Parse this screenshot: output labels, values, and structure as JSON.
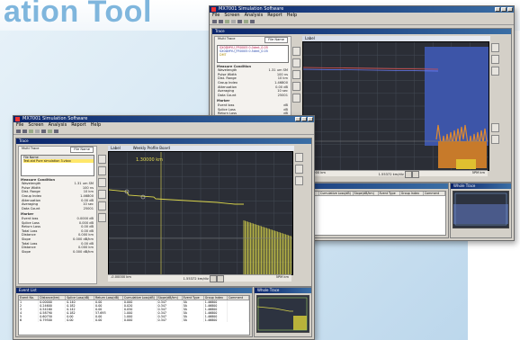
{
  "banner": {
    "title": "ation Tool"
  },
  "colors": {
    "plot_bg": "#2b2e36",
    "trace": "#d8d34a",
    "title_bar": "#0a246a"
  },
  "back_window": {
    "title": "MX7001 Simulation Software",
    "menu": [
      "File",
      "Screen",
      "Analysis",
      "Report",
      "Help"
    ],
    "frame_title": "Trace",
    "panel": {
      "select_label": "Multi Trace",
      "select_value": "File Name",
      "files": [
        "SX0DMYU_FR0005 0.0dmt_0.05",
        "SX0DMYU_FR0005 0.5dmt_0.05",
        "DMT"
      ],
      "sect_measure": "Measure Condition",
      "measure": [
        [
          "Wavelength",
          "1.31 um SM"
        ],
        [
          "Pulse Width",
          "100 ns"
        ],
        [
          "Dist. Range",
          "10 km"
        ],
        [
          "Group Index",
          "1.46800"
        ],
        [
          "Attenuation",
          "0.00 dB"
        ],
        [
          "Averaging",
          "10 sec"
        ],
        [
          "Data Count",
          "25001"
        ]
      ],
      "sect_marker": "Marker",
      "marker": [
        [
          "Event loss",
          "dB"
        ],
        [
          "Splice Loss",
          "dB"
        ],
        [
          "Return Loss",
          "dB"
        ],
        [
          "Distance",
          "dB"
        ],
        [
          "Slope",
          "dB/km"
        ],
        [
          "Total Loss",
          "dB"
        ],
        [
          "Distance",
          "km"
        ],
        [
          "Slope",
          "dB/km"
        ]
      ]
    },
    "plot_tab": "Label",
    "status": {
      "left": "-0.00000 km",
      "mid": "1.55372 km/div",
      "right": "5PM   km"
    },
    "event_title": "Event List",
    "event_cols": [
      "Event No.",
      "Distance(km)",
      "Splice Loss(dB)",
      "Return Loss(dB)",
      "Cumulative Loss(dB)",
      "Slope(dB/km)",
      "Event Type",
      "Group Index",
      "Comment"
    ],
    "mini_title": "Whole Trace"
  },
  "front_window": {
    "title": "MX7001 Simulation Software",
    "menu": [
      "File",
      "Screen",
      "Analysis",
      "Report",
      "Help"
    ],
    "frame_title": "Trace",
    "panel": {
      "select_label": "Multi Trace",
      "select_value": "File Name",
      "files": [
        "File Name",
        "Test.std Pure simulation 3.vbxx"
      ],
      "sect_measure": "Measure Condition",
      "measure": [
        [
          "Wavelength",
          "1.31 um SM"
        ],
        [
          "Pulse Width",
          "100 ns"
        ],
        [
          "Dist. Range",
          "10 km"
        ],
        [
          "Group Index",
          "1.46800"
        ],
        [
          "Attenuation",
          "0.00 dB"
        ],
        [
          "Averaging",
          "10 sec"
        ],
        [
          "Data Count",
          "25001"
        ]
      ],
      "sect_marker": "Marker",
      "marker": [
        [
          "Event loss",
          "0.0000 dB"
        ],
        [
          "Splice Loss",
          "0.000 dB"
        ],
        [
          "Return Loss",
          "0.00 dB"
        ],
        [
          "Total Loss",
          "0.00 dB"
        ],
        [
          "Distance",
          "0.000 km"
        ],
        [
          "Slope",
          "0.000 dB/km"
        ],
        [
          "Total Loss",
          "0.00 dB"
        ],
        [
          "Distance",
          "0.000 km"
        ],
        [
          "Slope",
          "0.000 dB/km"
        ]
      ]
    },
    "plot_tabs": [
      "Label",
      "Weekly Profile Board"
    ],
    "plot_readout": "1.30000 km",
    "status": {
      "left": "-0.00000 km",
      "mid": "1.55372 km/div",
      "right": "5PM   km"
    },
    "event_title": "Event List",
    "event_cols": [
      "Event No.",
      "Distance(km)",
      "Splice Loss(dB)",
      "Return Loss(dB)",
      "Cumulative Loss(dB)",
      "Slope(dB/km)",
      "Event Type",
      "Group Index",
      "Comment"
    ],
    "event_rows": [
      [
        "1",
        "0.00000",
        "0.140",
        "0.00",
        "0.000",
        "0.347",
        "5A",
        "1.46800",
        ""
      ],
      [
        "2",
        "0.24600",
        "0.182",
        "0.00",
        "0.020",
        "0.347",
        "5A",
        "1.46800",
        ""
      ],
      [
        "3",
        "0.54160",
        "0.142",
        "0.00",
        "0.050",
        "0.347",
        "5A",
        "1.46800",
        ""
      ],
      [
        "4",
        "0.58790",
        "0.182",
        "57.693",
        "1.000",
        "0.347",
        "5A",
        "1.46800",
        ""
      ],
      [
        "5",
        "0.60750",
        "0.00",
        "0.00",
        "1.000",
        "0.347",
        "5A",
        "1.46800",
        ""
      ],
      [
        "6",
        "0.79500",
        "0.00",
        "0.00",
        "0.000",
        "0.347",
        "5A",
        "1.46800",
        ""
      ]
    ],
    "mini_title": "Whole Trace"
  }
}
